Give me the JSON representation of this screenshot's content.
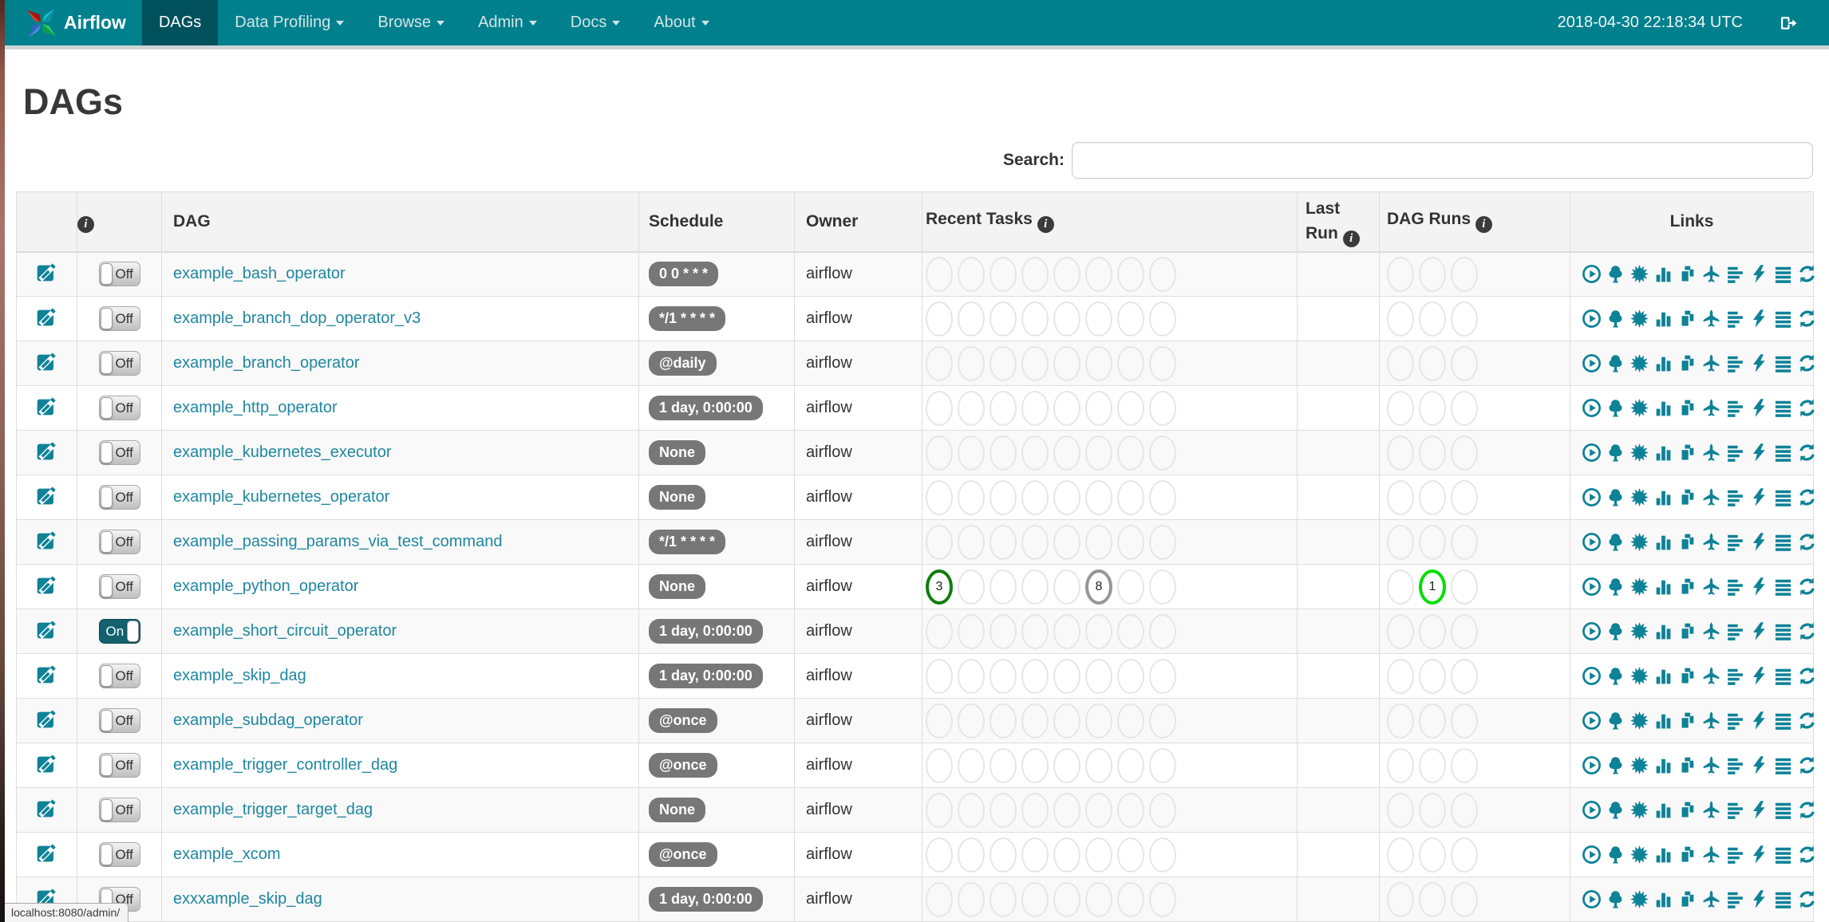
{
  "navbar": {
    "brand": "Airflow",
    "items": [
      {
        "label": "DAGs",
        "active": true,
        "caret": false
      },
      {
        "label": "Data Profiling",
        "active": false,
        "caret": true
      },
      {
        "label": "Browse",
        "active": false,
        "caret": true
      },
      {
        "label": "Admin",
        "active": false,
        "caret": true
      },
      {
        "label": "Docs",
        "active": false,
        "caret": true
      },
      {
        "label": "About",
        "active": false,
        "caret": true
      }
    ],
    "clock": "2018-04-30 22:18:34 UTC",
    "signout_icon": "sign-out-icon"
  },
  "page": {
    "title": "DAGs",
    "search_label": "Search:",
    "search_value": "",
    "status_bar": "localhost:8080/admin/"
  },
  "table": {
    "headers": {
      "dag": "DAG",
      "schedule": "Schedule",
      "owner": "Owner",
      "recent_tasks": "Recent Tasks",
      "last_run": "Last Run",
      "dag_runs": "DAG Runs",
      "links": "Links"
    },
    "recent_task_slots": 8,
    "dag_run_slots": 3,
    "links_icons": [
      "trigger-dag-icon",
      "tree-view-icon",
      "graph-view-icon",
      "task-duration-icon",
      "task-tries-icon",
      "landing-times-icon",
      "gantt-icon",
      "code-icon",
      "logs-icon",
      "refresh-icon"
    ],
    "rows": [
      {
        "dag": "example_bash_operator",
        "toggle": "Off",
        "schedule": "0 0 * * *",
        "owner": "airflow",
        "last_run": "",
        "recent_tasks": [],
        "dag_runs": []
      },
      {
        "dag": "example_branch_dop_operator_v3",
        "toggle": "Off",
        "schedule": "*/1 * * * *",
        "owner": "airflow",
        "last_run": "",
        "recent_tasks": [],
        "dag_runs": []
      },
      {
        "dag": "example_branch_operator",
        "toggle": "Off",
        "schedule": "@daily",
        "owner": "airflow",
        "last_run": "",
        "recent_tasks": [],
        "dag_runs": []
      },
      {
        "dag": "example_http_operator",
        "toggle": "Off",
        "schedule": "1 day, 0:00:00",
        "owner": "airflow",
        "last_run": "",
        "recent_tasks": [],
        "dag_runs": []
      },
      {
        "dag": "example_kubernetes_executor",
        "toggle": "Off",
        "schedule": "None",
        "owner": "airflow",
        "last_run": "",
        "recent_tasks": [],
        "dag_runs": []
      },
      {
        "dag": "example_kubernetes_operator",
        "toggle": "Off",
        "schedule": "None",
        "owner": "airflow",
        "last_run": "",
        "recent_tasks": [],
        "dag_runs": []
      },
      {
        "dag": "example_passing_params_via_test_command",
        "toggle": "Off",
        "schedule": "*/1 * * * *",
        "owner": "airflow",
        "last_run": "",
        "recent_tasks": [],
        "dag_runs": []
      },
      {
        "dag": "example_python_operator",
        "toggle": "Off",
        "schedule": "None",
        "owner": "airflow",
        "last_run": "",
        "recent_tasks": [
          {
            "slot": 0,
            "count": 3,
            "state": "success"
          },
          {
            "slot": 5,
            "count": 8,
            "state": "none"
          }
        ],
        "dag_runs": [
          {
            "slot": 1,
            "count": 1,
            "state": "running"
          }
        ]
      },
      {
        "dag": "example_short_circuit_operator",
        "toggle": "On",
        "schedule": "1 day, 0:00:00",
        "owner": "airflow",
        "last_run": "",
        "recent_tasks": [],
        "dag_runs": []
      },
      {
        "dag": "example_skip_dag",
        "toggle": "Off",
        "schedule": "1 day, 0:00:00",
        "owner": "airflow",
        "last_run": "",
        "recent_tasks": [],
        "dag_runs": []
      },
      {
        "dag": "example_subdag_operator",
        "toggle": "Off",
        "schedule": "@once",
        "owner": "airflow",
        "last_run": "",
        "recent_tasks": [],
        "dag_runs": []
      },
      {
        "dag": "example_trigger_controller_dag",
        "toggle": "Off",
        "schedule": "@once",
        "owner": "airflow",
        "last_run": "",
        "recent_tasks": [],
        "dag_runs": []
      },
      {
        "dag": "example_trigger_target_dag",
        "toggle": "Off",
        "schedule": "None",
        "owner": "airflow",
        "last_run": "",
        "recent_tasks": [],
        "dag_runs": []
      },
      {
        "dag": "example_xcom",
        "toggle": "Off",
        "schedule": "@once",
        "owner": "airflow",
        "last_run": "",
        "recent_tasks": [],
        "dag_runs": []
      },
      {
        "dag": "exxxample_skip_dag",
        "toggle": "Off",
        "schedule": "1 day, 0:00:00",
        "owner": "airflow",
        "last_run": "",
        "recent_tasks": [],
        "dag_runs": []
      }
    ]
  },
  "colors": {
    "navbar_bg": "#00808d",
    "navbar_active_bg": "#00515c",
    "link": "#1f87a0",
    "icon": "#0e8297",
    "badge_bg": "#777777",
    "task_states": {
      "success": "#0f7d0f",
      "none": "#969696",
      "running": "#00df00"
    }
  }
}
